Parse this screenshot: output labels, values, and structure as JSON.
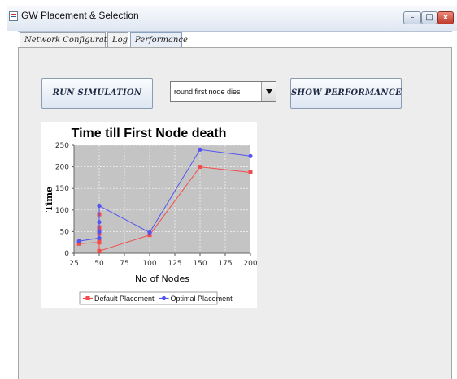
{
  "window": {
    "title": "GW Placement & Selection",
    "controls": {
      "minimize": "–",
      "maximize": "□",
      "close": "x"
    }
  },
  "tabs": [
    {
      "label": "Network Configuration"
    },
    {
      "label": "Log"
    },
    {
      "label": "Performance",
      "selected": true
    }
  ],
  "toolbar": {
    "run_label": "RUN SIMULATION",
    "metric_select_value": "round first node dies",
    "show_label": "SHOW PERFORMANCE"
  },
  "chart_data": {
    "type": "line",
    "title": "Time till First Node death",
    "xlabel": "No of Nodes",
    "ylabel": "Time",
    "xlim": [
      25,
      200
    ],
    "ylim": [
      0,
      250
    ],
    "xticks": [
      25,
      50,
      75,
      100,
      125,
      150,
      175,
      200
    ],
    "yticks": [
      0,
      50,
      100,
      150,
      200,
      250
    ],
    "grid": true,
    "legend_position": "bottom",
    "series": [
      {
        "name": "Default Placement",
        "color": "#f24c4c",
        "marker": "square",
        "x": [
          30,
          50,
          50,
          50,
          50,
          50,
          50,
          50,
          50,
          100,
          150,
          200
        ],
        "y": [
          22,
          25,
          30,
          45,
          50,
          55,
          60,
          90,
          5,
          42,
          200,
          187
        ]
      },
      {
        "name": "Optimal Placement",
        "color": "#5454f2",
        "marker": "circle",
        "x": [
          30,
          50,
          50,
          50,
          50,
          100,
          150,
          200
        ],
        "y": [
          28,
          35,
          50,
          72,
          110,
          48,
          240,
          225
        ]
      }
    ]
  }
}
